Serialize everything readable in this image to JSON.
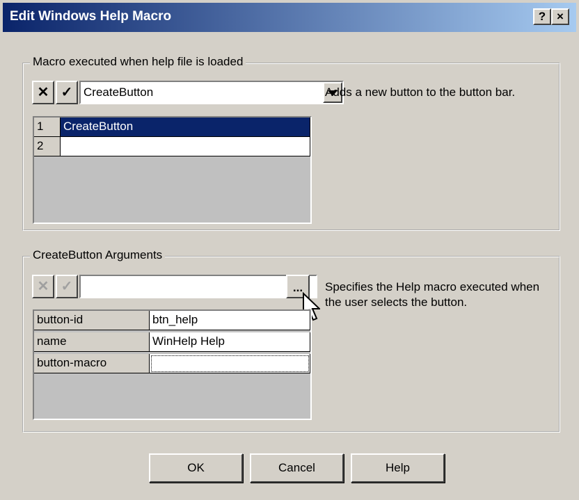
{
  "window": {
    "title": "Edit Windows Help Macro",
    "help_glyph": "?",
    "close_glyph": "×"
  },
  "macro_group": {
    "label": "Macro executed when help file is loaded",
    "combo_value": "CreateButton",
    "description": "Adds a new button to the button bar.",
    "rows": [
      {
        "num": "1",
        "value": "CreateButton",
        "selected": true
      },
      {
        "num": "2",
        "value": "",
        "selected": false
      }
    ]
  },
  "args_group": {
    "label": "CreateButton Arguments",
    "input_value": "",
    "browse_label": "...",
    "description": "Specifies the Help macro executed when the user selects the button.",
    "rows": [
      {
        "name": "button-id",
        "value": "btn_help"
      },
      {
        "name": "name",
        "value": "WinHelp Help"
      },
      {
        "name": "button-macro",
        "value": ""
      }
    ]
  },
  "buttons": {
    "ok": "OK",
    "cancel": "Cancel",
    "help": "Help"
  },
  "colors": {
    "title_start": "#0a246a",
    "title_end": "#a6caf0",
    "selection": "#0a246a",
    "face": "#d4d0c8"
  }
}
